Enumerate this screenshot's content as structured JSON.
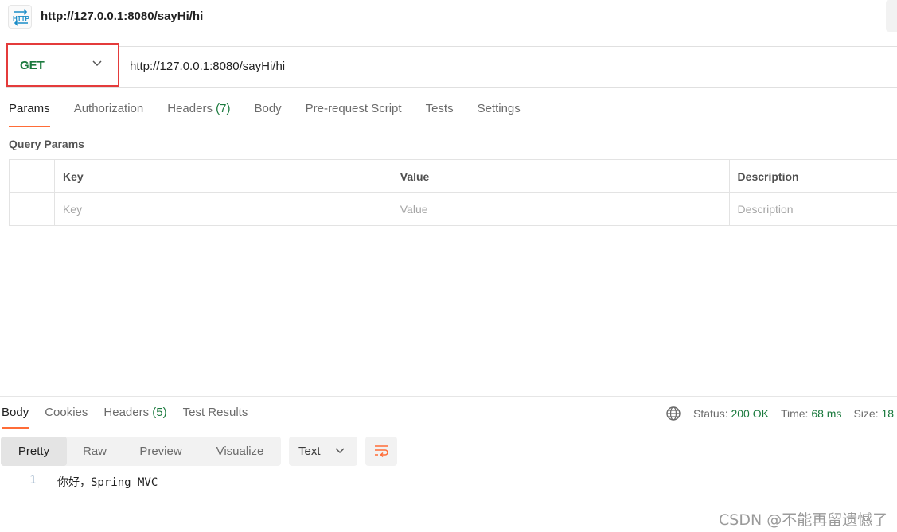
{
  "request": {
    "title": "http://127.0.0.1:8080/sayHi/hi",
    "icon": "http-icon",
    "method": "GET",
    "url": "http://127.0.0.1:8080/sayHi/hi"
  },
  "request_tabs": [
    {
      "label": "Params",
      "active": true
    },
    {
      "label": "Authorization"
    },
    {
      "label": "Headers ",
      "count": "(7)"
    },
    {
      "label": "Body"
    },
    {
      "label": "Pre-request Script"
    },
    {
      "label": "Tests"
    },
    {
      "label": "Settings"
    }
  ],
  "query_params": {
    "title": "Query Params",
    "columns": [
      "Key",
      "Value",
      "Description"
    ],
    "placeholders": [
      "Key",
      "Value",
      "Description"
    ]
  },
  "response_tabs": [
    {
      "label": "Body",
      "active": true
    },
    {
      "label": "Cookies"
    },
    {
      "label": "Headers ",
      "count": "(5)"
    },
    {
      "label": "Test Results"
    }
  ],
  "response_meta": {
    "status_label": "Status: ",
    "status_value": "200 OK",
    "time_label": "Time: ",
    "time_value": "68 ms",
    "size_label": "Size: ",
    "size_value": "18"
  },
  "format_buttons": [
    "Pretty",
    "Raw",
    "Preview",
    "Visualize"
  ],
  "language": "Text",
  "response_body": [
    {
      "line": "1",
      "text": "你好，Spring MVC"
    }
  ],
  "watermark": "CSDN @不能再留遗憾了",
  "colors": {
    "accent": "#ff6c37",
    "success": "#1b7a3e",
    "highlight_border": "#e43b3b"
  }
}
